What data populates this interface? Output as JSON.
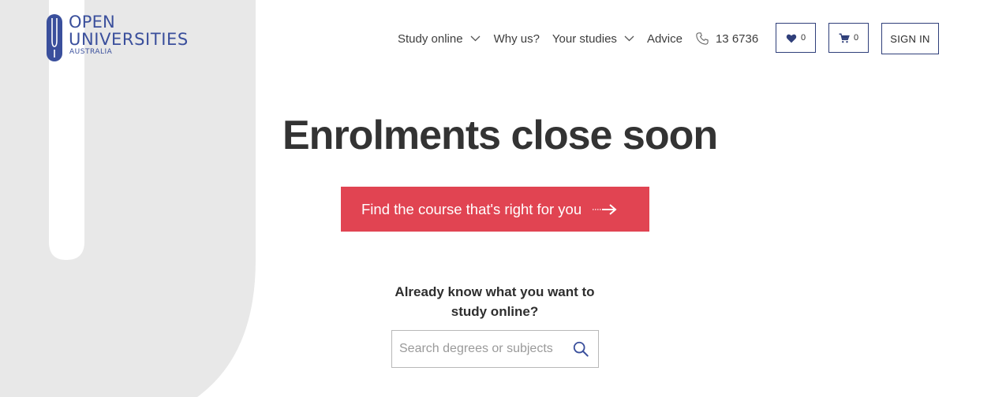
{
  "logo": {
    "line1": "OPEN",
    "line2": "UNIVERSITIES",
    "line3": "AUSTRALIA"
  },
  "nav": {
    "study_online": "Study online",
    "why_us": "Why us?",
    "your_studies": "Your studies",
    "advice": "Advice",
    "phone": "13 6736"
  },
  "header_buttons": {
    "wishlist_count": "0",
    "cart_count": "0",
    "signin_label": "SIGN IN"
  },
  "hero": {
    "title": "Enrolments close soon",
    "cta_label": "Find the course that's right for you"
  },
  "search": {
    "heading": "Already know what you want to study online?",
    "placeholder": "Search degrees or subjects",
    "value": ""
  },
  "icons": [
    "heart-icon",
    "cart-icon",
    "phone-icon",
    "chevron-down-icon",
    "arrow-right-icon",
    "search-icon"
  ],
  "colors": {
    "brand_blue": "#3a4f9c",
    "cta_red": "#e14452",
    "bg_grey": "#e8e8e8",
    "border_navy": "#2f3f7a"
  }
}
